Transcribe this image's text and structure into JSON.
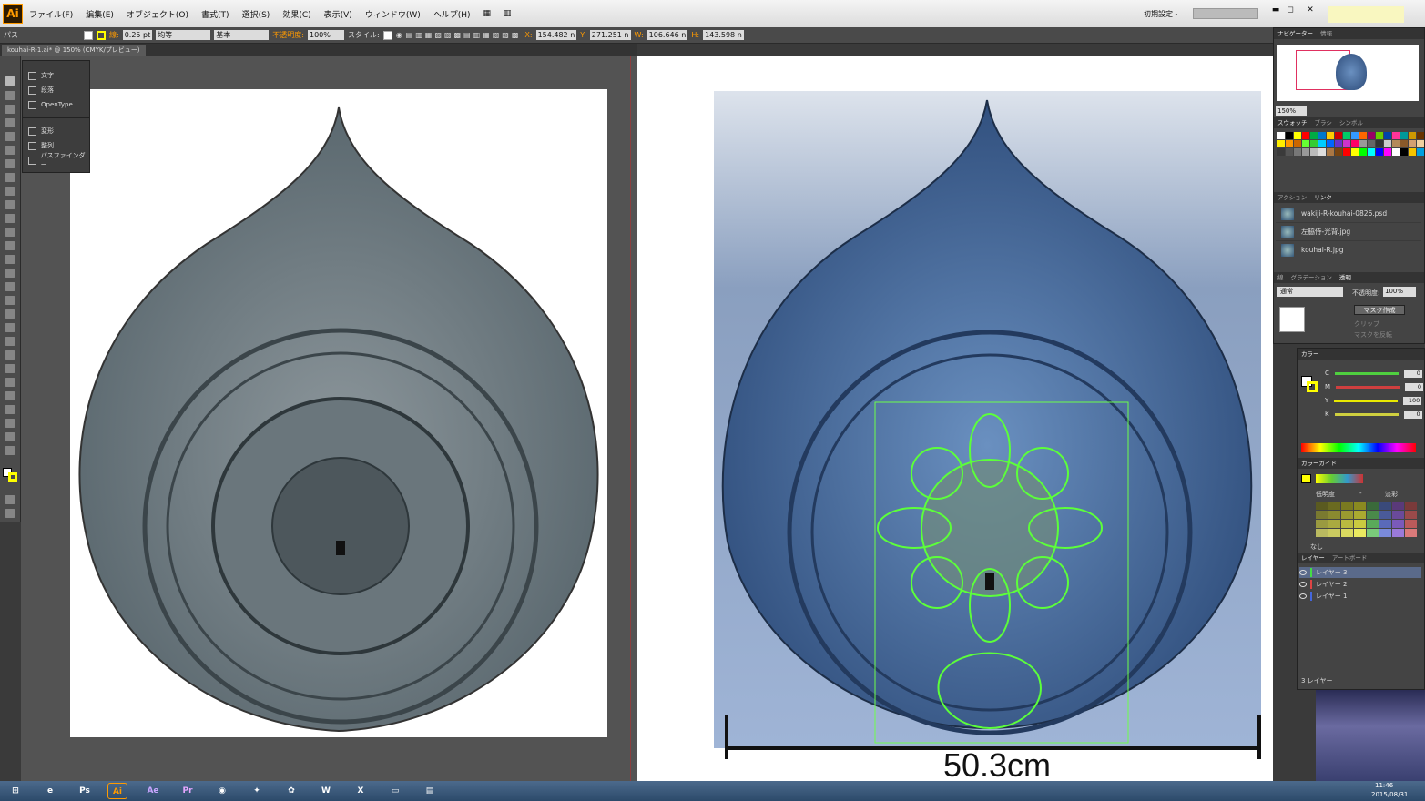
{
  "app": {
    "logo": "Ai",
    "workspace": "初期設定 -"
  },
  "menu": [
    "ファイル(F)",
    "編集(E)",
    "オブジェクト(O)",
    "書式(T)",
    "選択(S)",
    "効果(C)",
    "表示(V)",
    "ウィンドウ(W)",
    "ヘルプ(H)"
  ],
  "window_controls": {
    "minimize": "▬",
    "restore": "◻",
    "close": "✕"
  },
  "control_bar": {
    "object_type": "パス",
    "stroke_label": "線:",
    "stroke_weight": "0.25 pt",
    "profile": "均等",
    "brush": "基本",
    "opacity_label": "不透明度:",
    "opacity": "100%",
    "style_label": "スタイル:",
    "x_label": "X:",
    "x": "154.482 n",
    "y_label": "Y:",
    "y": "271.251 n",
    "w_label": "W:",
    "w": "106.646 n",
    "h_label": "H:",
    "h": "143.598 n"
  },
  "document_tab": "kouhai-R-1.ai* @ 150% (CMYK/プレビュー)",
  "flyout": {
    "items": [
      "文字",
      "段落",
      "OpenType",
      "変形",
      "整列",
      "パスファインダー"
    ]
  },
  "navigator": {
    "tabs": [
      "ナビゲーター",
      "情報"
    ],
    "zoom": "150%"
  },
  "swatches_tabs": [
    "スウォッチ",
    "ブラシ",
    "シンボル"
  ],
  "swatch_colors": [
    "#ffffff",
    "#000000",
    "#ffff00",
    "#ff0000",
    "#00aa44",
    "#0077cc",
    "#ffcc00",
    "#cc0000",
    "#00cc66",
    "#3399ff",
    "#ff6600",
    "#990066",
    "#66cc00",
    "#0044aa",
    "#ff3399",
    "#009999",
    "#cc9900",
    "#663300",
    "#ffee00",
    "#ff9900",
    "#cc6600",
    "#66ff33",
    "#33cc33",
    "#00ccff",
    "#0066ff",
    "#6633cc",
    "#cc33cc",
    "#ff0066",
    "#999999",
    "#666666",
    "#333333",
    "#cccccc",
    "#b38a5a",
    "#8a5a2a",
    "#d4a070",
    "#f0d0a0",
    "#3a3a3a",
    "#555555",
    "#777777",
    "#999999",
    "#bbbbbb",
    "#dddddd",
    "#aa7744",
    "#774411",
    "#ff0000",
    "#ffff00",
    "#00ff00",
    "#00ffff",
    "#0000ff",
    "#ff00ff",
    "#ffffff",
    "#000000",
    "#f5c400",
    "#00a0e0"
  ],
  "links_tabs": [
    "アクション",
    "リンク"
  ],
  "links": [
    "wakiji-R-kouhai-0826.psd",
    "左脇侍-光背.jpg",
    "kouhai-R.jpg"
  ],
  "transparency_tabs": [
    "線",
    "グラデーション",
    "透明"
  ],
  "transparency": {
    "mode": "通常",
    "opacity_label": "不透明度:",
    "opacity": "100%",
    "mask_button": "マスク作成",
    "clip": "クリップ",
    "invert": "マスクを反転"
  },
  "color_panel": {
    "title": "カラー",
    "channels": [
      {
        "label": "C",
        "value": "0",
        "color": "#4fcf3f"
      },
      {
        "label": "M",
        "value": "0",
        "color": "#cf3f3f"
      },
      {
        "label": "Y",
        "value": "100",
        "color": "#e8e800"
      },
      {
        "label": "K",
        "value": "0",
        "color": "#cfcf3f"
      }
    ],
    "percent": "%"
  },
  "color_guide": {
    "title": "カラーガイド",
    "low": "低明度",
    "dash": "-",
    "high": "淡彩",
    "none_label": "なし",
    "cells": [
      "#5a5a20",
      "#6a6a20",
      "#7a7a20",
      "#8a8a20",
      "#3a6a3a",
      "#3a4a7a",
      "#5a3a7a",
      "#7a3a3a",
      "#7a7a30",
      "#8a8a30",
      "#9a9a30",
      "#aaaa30",
      "#4a8a4a",
      "#4a5a9a",
      "#6a4a9a",
      "#9a4a4a",
      "#9a9a40",
      "#aaaa40",
      "#baba40",
      "#caca40",
      "#5aaa5a",
      "#5a6aba",
      "#7a5aba",
      "#ba5a5a",
      "#baba60",
      "#caca60",
      "#dada60",
      "#eaea60",
      "#7aca7a",
      "#7a8ada",
      "#9a7ada",
      "#da7a7a"
    ]
  },
  "layers": {
    "tabs": [
      "レイヤー",
      "アートボード"
    ],
    "rows": [
      {
        "name": "レイヤー 3",
        "color": "#44dd44",
        "active": true
      },
      {
        "name": "レイヤー 2",
        "color": "#dd4444",
        "active": false
      },
      {
        "name": "レイヤー 1",
        "color": "#4466dd",
        "active": false
      }
    ],
    "count": "3 レイヤー"
  },
  "measurement": "50.3cm",
  "taskbar": {
    "apps": [
      {
        "label": "⊞",
        "color": "#1e6fd0"
      },
      {
        "label": "e",
        "color": "#1a8fd8"
      },
      {
        "label": "Ps",
        "color": "#0a1d3a"
      },
      {
        "label": "Ai",
        "color": "#3a1a00"
      },
      {
        "label": "Ae",
        "color": "#1a0a3a"
      },
      {
        "label": "Pr",
        "color": "#2a0a3a"
      },
      {
        "label": "◉",
        "color": "#d8342a"
      },
      {
        "label": "✦",
        "color": "#3a7a9a"
      },
      {
        "label": "✿",
        "color": "#7a4a6a"
      },
      {
        "label": "W",
        "color": "#1a4a9a"
      },
      {
        "label": "X",
        "color": "#1a7a3a"
      },
      {
        "label": "▭",
        "color": "#5a8a2a"
      },
      {
        "label": "▤",
        "color": "#c89a2a"
      }
    ],
    "time": "11:46",
    "date": "2015/08/31"
  }
}
